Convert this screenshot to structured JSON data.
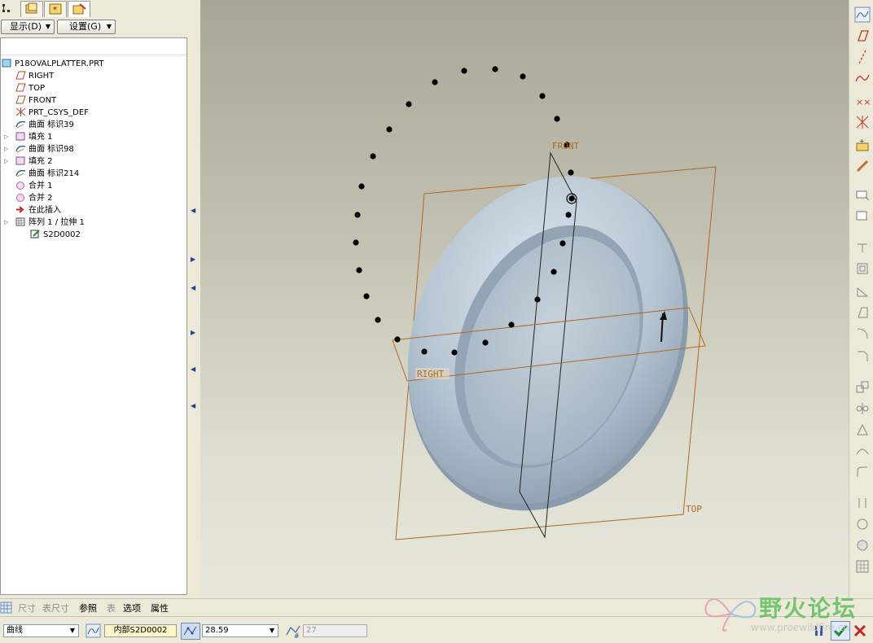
{
  "left_panel": {
    "toolbar": {
      "display_label": "显示(D)",
      "settings_label": "设置(G)"
    },
    "tree": [
      {
        "label": "P18OVALPLATTER.PRT",
        "icon": "part-icon",
        "indent": 0
      },
      {
        "label": "RIGHT",
        "icon": "datum-plane-icon",
        "indent": 1
      },
      {
        "label": "TOP",
        "icon": "datum-plane-icon",
        "indent": 1
      },
      {
        "label": "FRONT",
        "icon": "datum-plane-icon",
        "indent": 1
      },
      {
        "label": "PRT_CSYS_DEF",
        "icon": "csys-icon",
        "indent": 1
      },
      {
        "label": "曲面 标识39",
        "icon": "surface-icon",
        "indent": 1
      },
      {
        "label": "填充 1",
        "icon": "fill-icon",
        "indent": 1
      },
      {
        "label": "曲面 标识98",
        "icon": "surface-icon",
        "indent": 1
      },
      {
        "label": "填充 2",
        "icon": "fill-icon",
        "indent": 1
      },
      {
        "label": "曲面 标识214",
        "icon": "surface-icon",
        "indent": 1
      },
      {
        "label": "合并 1",
        "icon": "merge-icon",
        "indent": 1
      },
      {
        "label": "合并 2",
        "icon": "merge-icon",
        "indent": 1
      },
      {
        "label": "在此插入",
        "icon": "insert-here-icon",
        "indent": 1
      },
      {
        "label": "阵列 1 / 拉伸 1",
        "icon": "pattern-icon",
        "indent": 1
      },
      {
        "label": "S2D0002",
        "icon": "sketch-icon",
        "indent": 2
      }
    ]
  },
  "viewport": {
    "datum_labels": {
      "front": "FRONT",
      "right": "RIGHT",
      "top": "TOP"
    },
    "colors": {
      "datum_plane": "#b06a1e",
      "plate": "#c3d0dc",
      "points": "#000000"
    }
  },
  "dashboard": {
    "tabs": [
      {
        "label": "尺寸",
        "enabled": false
      },
      {
        "label": "表尺寸",
        "enabled": false
      },
      {
        "label": "参照",
        "enabled": true
      },
      {
        "label": "表",
        "enabled": false
      },
      {
        "label": "选项",
        "enabled": true
      },
      {
        "label": "属性",
        "enabled": true
      }
    ],
    "curve_type": "曲线",
    "internal_sketch": "内部S2D0002",
    "increment_value": "28.59",
    "count_value": "27"
  },
  "watermark": {
    "text": "野火论坛",
    "url": "www.proewildfire.cn"
  }
}
